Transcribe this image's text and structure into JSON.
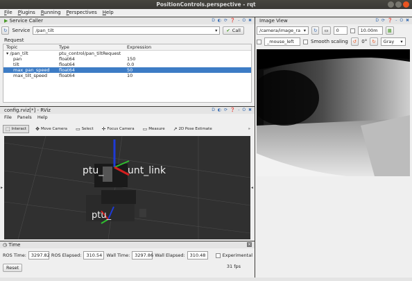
{
  "window": {
    "title": "PositionControls.perspective - rqt"
  },
  "menubar": [
    "File",
    "Plugins",
    "Running",
    "Perspectives",
    "Help"
  ],
  "service_caller": {
    "title": "Service Caller",
    "dock_icons": "D ◐ ⟳ ❓ - O ✖",
    "service_label": "Service",
    "service_value": "/pan_tilt",
    "call_label": "Call",
    "request_label": "Request",
    "columns": [
      "Topic",
      "Type",
      "Expression"
    ],
    "rows": [
      {
        "topic": "▾ /pan_tilt",
        "type": "ptu_control/pan_tiltRequest",
        "expr": "",
        "selected": false
      },
      {
        "topic": "pan",
        "type": "float64",
        "expr": "150",
        "selected": false
      },
      {
        "topic": "tilt",
        "type": "float64",
        "expr": "0.0",
        "selected": false
      },
      {
        "topic": "max_pan_speed",
        "type": "float64",
        "expr": "50",
        "selected": true
      },
      {
        "topic": "max_tilt_speed",
        "type": "float64",
        "expr": "10",
        "selected": false
      }
    ]
  },
  "image_view": {
    "title": "Image View",
    "dock_icons": "D ⟳ ❓ - O ✖",
    "topic": "/camera/image_ra",
    "num_value": "0",
    "distance": "10.00m",
    "mouse_topic": "_mouse_left",
    "smooth_label": "Smooth scaling",
    "rotation": "0°",
    "colormap": "Gray"
  },
  "rviz": {
    "title": "config.rviz[*] - RViz",
    "dock_icons": "D ◐ ⟳ ❓ - O ✖",
    "menu": [
      "File",
      "Panels",
      "Help"
    ],
    "tools": [
      {
        "label": "Interact",
        "glyph": "⬚",
        "active": true
      },
      {
        "label": "Move Camera",
        "glyph": "✥",
        "active": false
      },
      {
        "label": "Select",
        "glyph": "▭",
        "active": false
      },
      {
        "label": "Focus Camera",
        "glyph": "✛",
        "active": false
      },
      {
        "label": "Measure",
        "glyph": "▭",
        "active": false
      },
      {
        "label": "2D Pose Estimate",
        "glyph": "↗",
        "active": false
      }
    ],
    "more": "»",
    "label_top": "ptu_",
    "label_top_right": "unt_link",
    "label_bottom": "ptu_"
  },
  "time": {
    "title": "Time",
    "ros_time_label": "ROS Time:",
    "ros_time": "3297.82",
    "ros_elapsed_label": "ROS Elapsed:",
    "ros_elapsed": "310.54",
    "wall_time_label": "Wall Time:",
    "wall_time": "3297.86",
    "wall_elapsed_label": "Wall Elapsed:",
    "wall_elapsed": "310.48",
    "experimental_label": "Experimental",
    "reset_label": "Reset",
    "fps": "31 fps"
  }
}
